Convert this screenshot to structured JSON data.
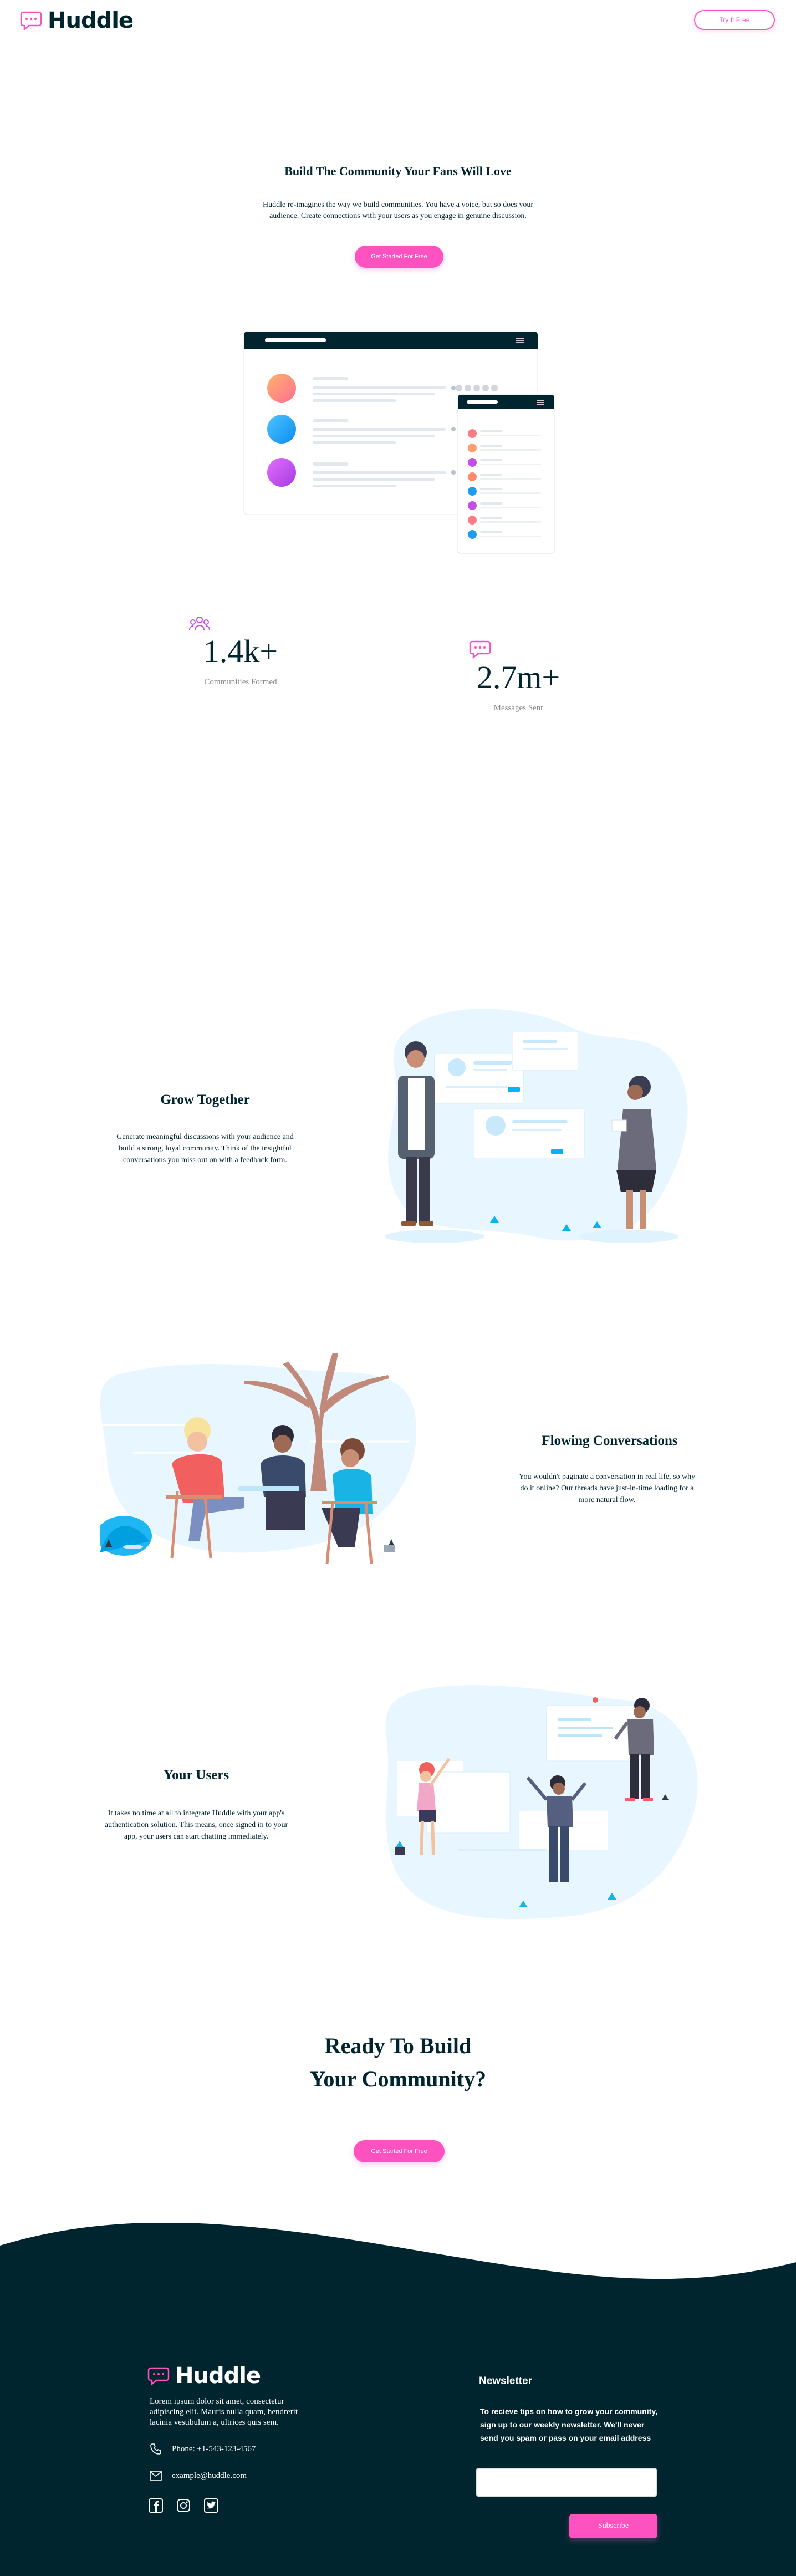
{
  "header": {
    "logo_text": "Huddle",
    "try_button": "Try It Free"
  },
  "hero": {
    "title": "Build The Community Your Fans Will Love",
    "description": "Huddle re-imagines the way we build communities. You have a voice, but so does your audience. Create connections with your users as you engage in genuine discussion.",
    "cta": "Get Started For Free"
  },
  "stats": [
    {
      "value": "1.4k+",
      "label": "Communities Formed",
      "icon": "communities-icon"
    },
    {
      "value": "2.7m+",
      "label": "Messages Sent",
      "icon": "messages-icon"
    }
  ],
  "features": [
    {
      "title": "Grow Together",
      "description": "Generate meaningful discussions with your audience and build a strong, loyal community. Think of the insightful conversations you miss out on with a feedback form."
    },
    {
      "title": "Flowing Conversations",
      "description": "You wouldn't paginate a conversation in real life, so why do it online? Our threads have just-in-time loading for a more natural flow."
    },
    {
      "title": "Your Users",
      "description": "It takes no time at all to integrate Huddle with your app's authentication solution. This means, once signed in to your app, your users can start chatting immediately."
    }
  ],
  "cta": {
    "title_line1": "Ready To Build",
    "title_line2": "Your Community?",
    "button": "Get Started For Free"
  },
  "footer": {
    "logo_text": "Huddle",
    "about": "Lorem ipsum dolor sit amet, consectetur adipiscing elit. Mauris nulla quam, hendrerit lacinia vestibulum a, ultrices quis sem.",
    "phone": "Phone: +1-543-123-4567",
    "email": "example@huddle.com",
    "social": [
      "facebook-icon",
      "instagram-icon",
      "twitter-icon"
    ],
    "newsletter": {
      "title": "Newsletter",
      "text": "To recieve tips on how to grow your community, sign up to our weekly newsletter. We'll never send you spam or pass on your email address",
      "input_value": "",
      "button": "Subscribe"
    }
  },
  "colors": {
    "pink": "#ff52c1",
    "dark": "#00252e",
    "light_blue": "#e8f7ff"
  }
}
